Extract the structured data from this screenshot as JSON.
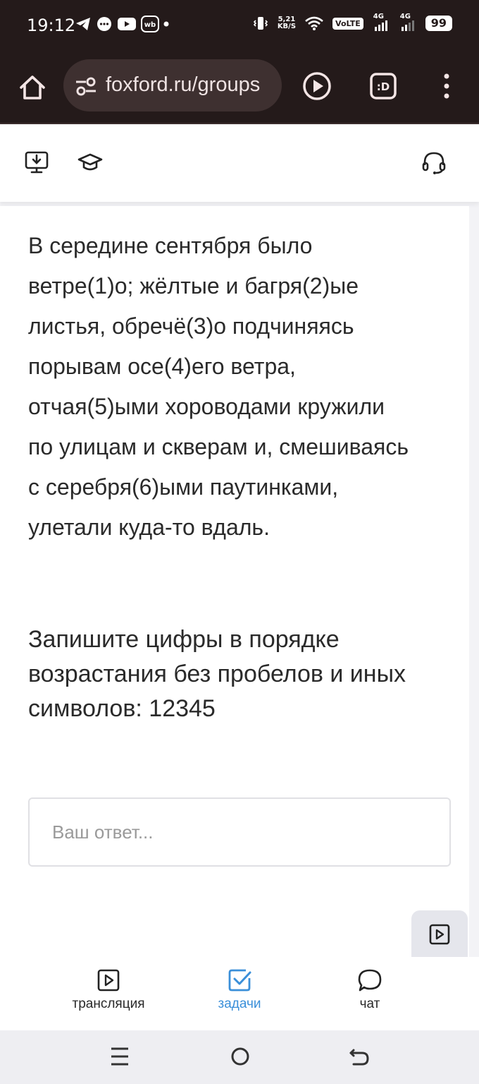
{
  "status_bar": {
    "time": "19:12",
    "net_speed_value": "5,21",
    "net_speed_unit": "KB/S",
    "volte": "VoLTE",
    "sim1_type": "4G",
    "sim2_type": "4G",
    "battery": "99",
    "notification_icons": [
      "telegram-icon",
      "messenger-icon",
      "youtube-icon",
      "wb-icon",
      "dot-icon"
    ]
  },
  "browser": {
    "url": "foxford.ru/groups",
    "icons": [
      "home-icon",
      "site-settings-icon",
      "play-icon",
      "extension-icon",
      "more-menu-icon"
    ]
  },
  "app_header": {
    "icons": [
      "download-screen-icon",
      "graduation-cap-icon",
      "headset-icon"
    ]
  },
  "task": {
    "passage_lines": [
      "В середине сентября было",
      "ветре(1)о; жёлтые и багря(2)ые",
      "листья, обречё(3)о подчиняясь",
      "порывам осе(4)его ветра,",
      "отчая(5)ыми хороводами кружили",
      "по улицам и скверам и, смешиваясь",
      "с серебря(6)ыми паутинками,",
      "улетали куда-то вдаль."
    ],
    "instruction_lines": [
      "Запишите цифры в порядке",
      "возрастания без пробелов и иных",
      "символов: 12345"
    ],
    "answer_placeholder": "Ваш ответ...",
    "answer_value": ""
  },
  "tabs": [
    {
      "label": "трансляция",
      "icon": "video-icon",
      "active": false
    },
    {
      "label": "задачи",
      "icon": "checkbox-icon",
      "active": true
    },
    {
      "label": "чат",
      "icon": "chat-bubble-icon",
      "active": false
    }
  ],
  "colors": {
    "browser_bg": "#241a1a",
    "active_tab": "#3a8fd9",
    "text": "#2a2a2a"
  }
}
